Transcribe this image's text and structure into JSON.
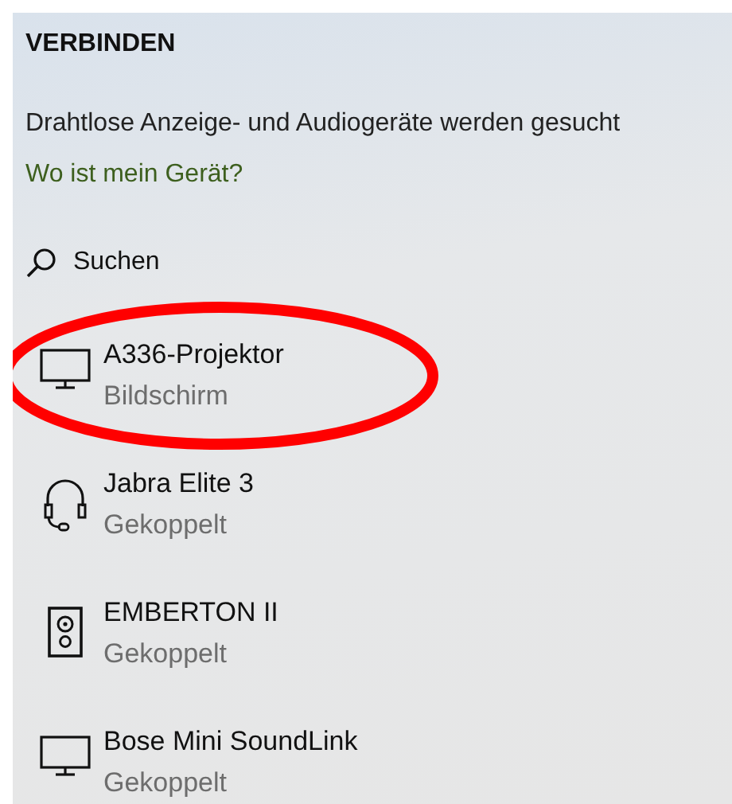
{
  "title": "VERBINDEN",
  "status_text": "Drahtlose Anzeige- und Audiogeräte werden gesucht",
  "help_link": "Wo ist mein Gerät?",
  "search": {
    "label": "Suchen"
  },
  "devices": [
    {
      "kind": "monitor",
      "name": "A336-Projektor",
      "status": "Bildschirm",
      "highlighted": true
    },
    {
      "kind": "headset",
      "name": "Jabra Elite 3",
      "status": "Gekoppelt",
      "highlighted": false
    },
    {
      "kind": "speaker",
      "name": "EMBERTON II",
      "status": "Gekoppelt",
      "highlighted": false
    },
    {
      "kind": "monitor",
      "name": "Bose Mini SoundLink",
      "status": "Gekoppelt",
      "highlighted": false
    }
  ]
}
